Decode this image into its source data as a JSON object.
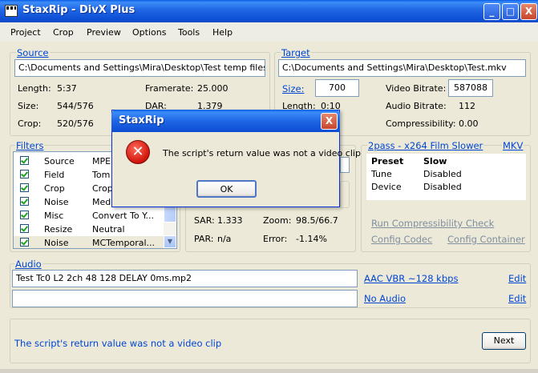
{
  "window": {
    "title": "StaxRip - DivX Plus",
    "controls": [
      "_",
      "□",
      "X"
    ]
  },
  "menu": [
    "Project",
    "Crop",
    "Preview",
    "Options",
    "Tools",
    "Help"
  ],
  "source": {
    "label": "Source",
    "path": "C:\\Documents and Settings\\Mira\\Desktop\\Test temp files\\",
    "length_label": "Length:",
    "length_value": "5:37",
    "framerate_label": "Framerate:",
    "framerate_value": "25.000",
    "size_label": "Size:",
    "size_value": "544/576",
    "dar_label": "DAR:",
    "dar_value": "1.379",
    "crop_label": "Crop:",
    "crop_value": "520/576"
  },
  "target": {
    "label": "Target",
    "path": "C:\\Documents and Settings\\Mira\\Desktop\\Test.mkv",
    "size_label": "Size:",
    "size_value": "700",
    "video_bitrate_label": "Video Bitrate:",
    "video_bitrate_value": "587088",
    "length_label": "Length:",
    "length_value": "0:10",
    "audio_bitrate_label": "Audio Bitrate:",
    "audio_bitrate_value": "112",
    "compressibility_label": "Compressibility:",
    "compressibility_value": "0.00"
  },
  "filters": {
    "label": "Filters",
    "items": [
      {
        "name": "Source",
        "value": "MPE"
      },
      {
        "name": "Field",
        "value": "Tom"
      },
      {
        "name": "Crop",
        "value": "Crop"
      },
      {
        "name": "Noise",
        "value": "Med"
      },
      {
        "name": "Misc",
        "value": "Convert To Y..."
      },
      {
        "name": "Resize",
        "value": "Neutral"
      },
      {
        "name": "Noise",
        "value": "MCTemporal..."
      }
    ]
  },
  "middle": {
    "sar_label": "SAR:",
    "sar_value": "1.333",
    "zoom_label": "Zoom:",
    "zoom_value": "98.5/66.7",
    "par_label": "PAR:",
    "par_value": "n/a",
    "error_label": "Error:",
    "error_value": "-1.14%"
  },
  "encoder": {
    "profile_link": "2pass - x264 Film Slower",
    "container_link": "MKV",
    "preset_label": "Preset",
    "preset_value": "Slow",
    "tune_label": "Tune",
    "tune_value": "Disabled",
    "device_label": "Device",
    "device_value": "Disabled",
    "run_check": "Run Compressibility Check",
    "config_codec": "Config Codec",
    "config_container": "Config Container"
  },
  "audio": {
    "label": "Audio",
    "track1": "Test Tc0 L2 2ch 48 128 DELAY 0ms.mp2",
    "track1_link": "AAC VBR ~128 kbps",
    "track2": "",
    "track2_link": "No Audio",
    "edit": "Edit"
  },
  "status": {
    "message": "The script's return value was not a video clip",
    "next": "Next"
  },
  "dialog": {
    "title": "StaxRip",
    "message": "The script's return value was not a video clip",
    "ok": "OK",
    "close": "X"
  },
  "colors": {
    "accent": "#0046D5",
    "titlebar": "#0A5EE8",
    "error": "#D0140A"
  }
}
